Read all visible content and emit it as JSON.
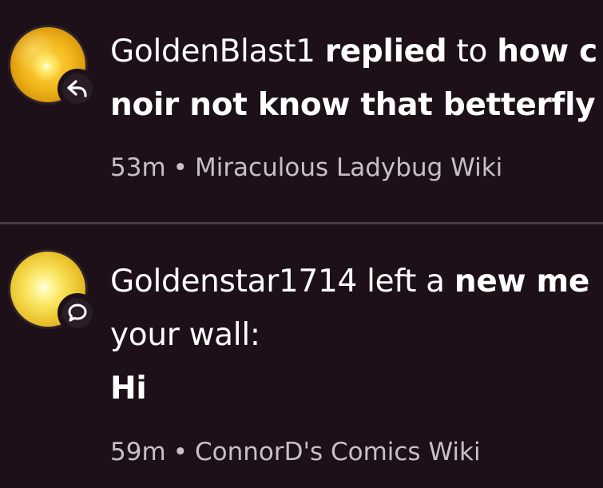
{
  "notifications": [
    {
      "user": "GoldenBlast1",
      "action": "replied",
      "connector": "to",
      "line1_bold_tail": "how c",
      "line2": "noir not know that betterfly",
      "time": "53m",
      "separator": "•",
      "wiki": "Miraculous Ladybug Wiki",
      "badge_icon": "reply-arrow-icon"
    },
    {
      "user": "Goldenstar1714",
      "action": "left a",
      "bold_phrase": "new me",
      "line2": "your wall:",
      "message": "Hi",
      "time": "59m",
      "separator": "•",
      "wiki": "ConnorD's Comics Wiki",
      "badge_icon": "message-bubble-icon"
    }
  ],
  "colors": {
    "background": "#1d1019",
    "divider": "#4a3b45",
    "meta_text": "#c9bfc6",
    "text": "#ffffff"
  }
}
